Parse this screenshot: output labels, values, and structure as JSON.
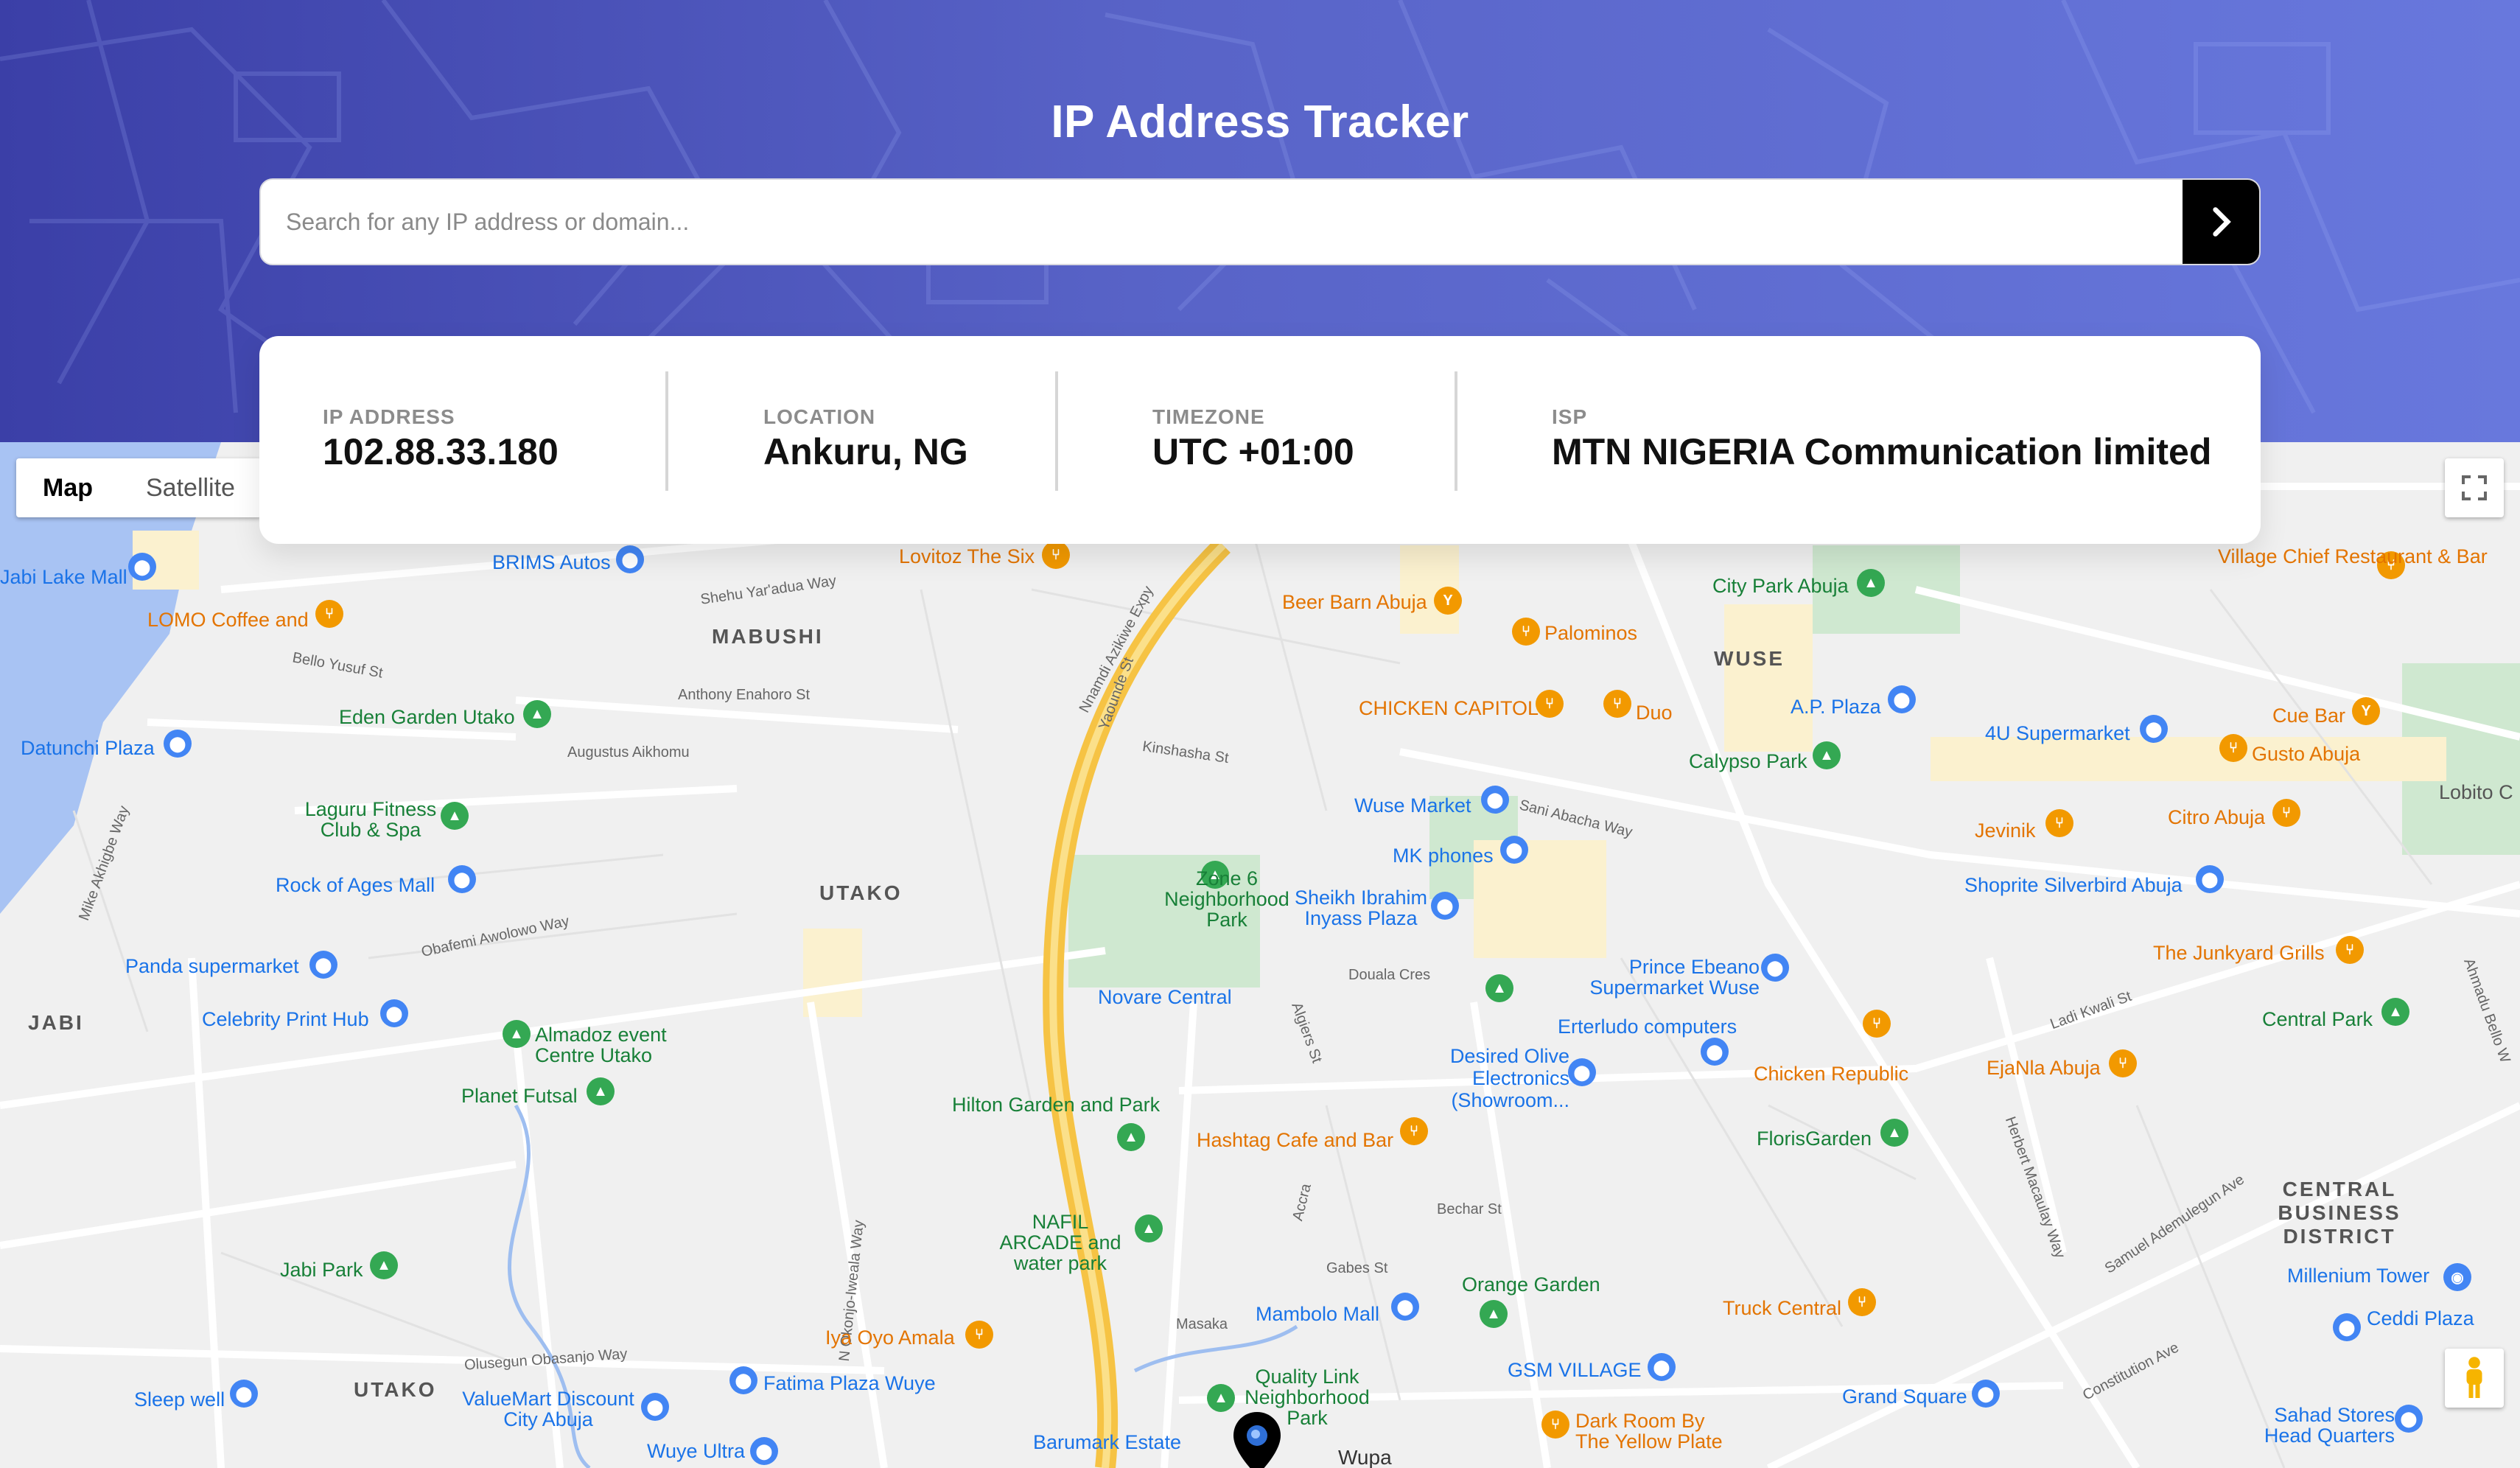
{
  "header": {
    "title": "IP Address Tracker",
    "search_placeholder": "Search for any IP address or domain...",
    "search_value": "",
    "submit_icon": "chevron-right-icon"
  },
  "info": [
    {
      "label": "IP ADDRESS",
      "value": "102.88.33.180"
    },
    {
      "label": "LOCATION",
      "value": "Ankuru, NG"
    },
    {
      "label": "TIMEZONE",
      "value": "UTC +01:00"
    },
    {
      "label": "ISP",
      "value": "MTN NIGERIA Communication limited"
    }
  ],
  "map": {
    "map_type": {
      "map": "Map",
      "satellite": "Satellite",
      "selected": "Map"
    },
    "areas": [
      "MABUSHI",
      "UTAKO",
      "JABI",
      "WUSE",
      "CENTRAL BUSINESS DISTRICT",
      "UTAKO",
      "Wupa"
    ],
    "places": [
      {
        "name": "BRIMS Autos",
        "kind": "shop"
      },
      {
        "name": "Lovitoz The Six",
        "kind": "food"
      },
      {
        "name": "Beer Barn Abuja",
        "kind": "food"
      },
      {
        "name": "Palominos",
        "kind": "food"
      },
      {
        "name": "City Park Abuja",
        "kind": "park"
      },
      {
        "name": "Village Chief Restaurant & Bar",
        "kind": "food"
      },
      {
        "name": "LOMO Coffee and",
        "kind": "food"
      },
      {
        "name": "Jabi Lake Mall",
        "kind": "shop"
      },
      {
        "name": "Eden Garden Utako",
        "kind": "park"
      },
      {
        "name": "Datunchi Plaza",
        "kind": "shop"
      },
      {
        "name": "Laguru Fitness Club & Spa",
        "kind": "park"
      },
      {
        "name": "Rock of Ages Mall",
        "kind": "shop"
      },
      {
        "name": "Panda supermarket",
        "kind": "shop"
      },
      {
        "name": "Celebrity Print Hub",
        "kind": "shop"
      },
      {
        "name": "Almadoz event Centre Utako",
        "kind": "park"
      },
      {
        "name": "Planet Futsal",
        "kind": "park"
      },
      {
        "name": "CHICKEN CAPITOL",
        "kind": "food"
      },
      {
        "name": "Duo",
        "kind": "food"
      },
      {
        "name": "A.P. Plaza",
        "kind": "shop"
      },
      {
        "name": "4U Supermarket",
        "kind": "shop"
      },
      {
        "name": "Cue Bar",
        "kind": "food"
      },
      {
        "name": "Gusto Abuja",
        "kind": "food"
      },
      {
        "name": "Calypso Park",
        "kind": "park"
      },
      {
        "name": "Wuse Market",
        "kind": "shop"
      },
      {
        "name": "MK phones",
        "kind": "shop"
      },
      {
        "name": "Jevinik",
        "kind": "food"
      },
      {
        "name": "Citro Abuja",
        "kind": "food"
      },
      {
        "name": "Shoprite Silverbird Abuja",
        "kind": "shop"
      },
      {
        "name": "Zone 6 Neighborhood Park",
        "kind": "park"
      },
      {
        "name": "Sheikh Ibrahim Inyass Plaza",
        "kind": "shop"
      },
      {
        "name": "Novare Central",
        "kind": "shop"
      },
      {
        "name": "Prince Ebeano Supermarket Wuse",
        "kind": "shop"
      },
      {
        "name": "The Junkyard Grills",
        "kind": "food"
      },
      {
        "name": "Erterludo computers",
        "kind": "shop"
      },
      {
        "name": "Desired Olive Electronics (Showroom...",
        "kind": "shop"
      },
      {
        "name": "Chicken Republic",
        "kind": "food"
      },
      {
        "name": "EjaNla Abuja",
        "kind": "food"
      },
      {
        "name": "Central Park",
        "kind": "park"
      },
      {
        "name": "Hilton Garden and Park",
        "kind": "park"
      },
      {
        "name": "Hashtag Cafe and Bar",
        "kind": "food"
      },
      {
        "name": "FlorisGarden",
        "kind": "park"
      },
      {
        "name": "NAFIL ARCADE and water park",
        "kind": "park"
      },
      {
        "name": "Jabi Park",
        "kind": "park"
      },
      {
        "name": "Orange Garden",
        "kind": "park"
      },
      {
        "name": "Mambolo Mall",
        "kind": "shop"
      },
      {
        "name": "Truck Central",
        "kind": "food"
      },
      {
        "name": "Millenium Tower",
        "kind": "landmark"
      },
      {
        "name": "Ceddi Plaza",
        "kind": "shop"
      },
      {
        "name": "Iya Oyo Amala",
        "kind": "food"
      },
      {
        "name": "Fatima Plaza Wuye",
        "kind": "shop"
      },
      {
        "name": "Quality Link Neighborhood Park",
        "kind": "park"
      },
      {
        "name": "GSM VILLAGE",
        "kind": "shop"
      },
      {
        "name": "Grand Square",
        "kind": "shop"
      },
      {
        "name": "Sleep well",
        "kind": "shop"
      },
      {
        "name": "ValueMart Discount City Abuja",
        "kind": "shop"
      },
      {
        "name": "Wuye Ultra",
        "kind": "shop"
      },
      {
        "name": "Barumark Estate",
        "kind": "shop"
      },
      {
        "name": "Dark Room By The Yellow Plate",
        "kind": "food"
      },
      {
        "name": "Sahad Stores Head Quarters",
        "kind": "shop"
      },
      {
        "name": "Lobito C",
        "kind": "area"
      }
    ],
    "streets": [
      "Shehu Yar'adua Way",
      "Nnamdi Azikiwe Expy",
      "Sani Abacha Way",
      "Obafemi Awolowo Way",
      "Augustus Aikhomu",
      "Olusegun Obasanjo Way",
      "N Okonjo-Iweala Way",
      "Herbert Macaulay Way",
      "Samuel Ademulegun Ave",
      "Constitution Ave",
      "Mike Akhigbe Way",
      "Ahmadu Bello W",
      "Ladi Kwali St",
      "Anthony Enahoro St",
      "Bello Yusuf St",
      "Yaounde St",
      "Kinshasha St",
      "Algiers St",
      "Douala Cres",
      "Masaka",
      "Accra",
      "Bechar St",
      "Gabes St"
    ],
    "marker_icon": "location-marker-icon",
    "fullscreen_icon": "fullscreen-icon",
    "pegman_icon": "street-view-pegman-icon"
  },
  "colors": {
    "accent": "#5863c7",
    "button": "#000000",
    "road_yellow": "#f6c344"
  }
}
